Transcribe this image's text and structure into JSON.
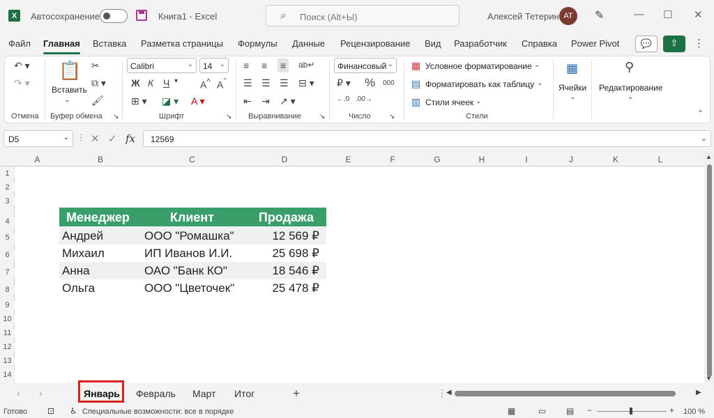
{
  "titlebar": {
    "app_letter": "X",
    "autosave": "Автосохранение",
    "title": "Книга1  -  Excel",
    "search": "Поиск (Alt+Ы)",
    "user": "Алексей Тетерин",
    "avatar": "АТ"
  },
  "tabs": [
    "Файл",
    "Главная",
    "Вставка",
    "Разметка страницы",
    "Формулы",
    "Данные",
    "Рецензирование",
    "Вид",
    "Разработчик",
    "Справка",
    "Power Pivot"
  ],
  "ribbon": {
    "groups": [
      "Отмена",
      "Буфер обмена",
      "Шрифт",
      "Выравнивание",
      "Число",
      "Стили"
    ],
    "paste": "Вставить",
    "font_name": "Calibri",
    "font_size": "14",
    "number_format": "Финансовый",
    "bold": "Ж",
    "italic": "К",
    "underline": "Ч",
    "styles": [
      "Условное форматирование",
      "Форматировать как таблицу",
      "Стили ячеек"
    ],
    "cells": "Ячейки",
    "editing": "Редактирование"
  },
  "formula": {
    "name_box": "D5",
    "fx": "fx",
    "value": "12569"
  },
  "columns": [
    "A",
    "B",
    "C",
    "D",
    "E",
    "F",
    "G",
    "H",
    "I",
    "J",
    "K",
    "L"
  ],
  "rows": [
    "1",
    "2",
    "3",
    "4",
    "5",
    "6",
    "7",
    "8",
    "9",
    "10",
    "11",
    "12",
    "13",
    "14"
  ],
  "table": {
    "headers": [
      "Менеджер",
      "Клиент",
      "Продажа"
    ],
    "rows": [
      [
        "Андрей",
        "ООО \"Ромашка\"",
        "12 569 ₽"
      ],
      [
        "Михаил",
        "ИП Иванов И.И.",
        "25 698 ₽"
      ],
      [
        "Анна",
        "ОАО \"Банк КО\"",
        "18 546 ₽"
      ],
      [
        "Ольга",
        "ООО \"Цветочек\"",
        "25 478 ₽"
      ]
    ]
  },
  "sheets": [
    "Январь",
    "Февраль",
    "Март",
    "Итог"
  ],
  "status": {
    "ready": "Готово",
    "accessibility": "Специальные возможности: все в порядке",
    "zoom": "100 %"
  }
}
